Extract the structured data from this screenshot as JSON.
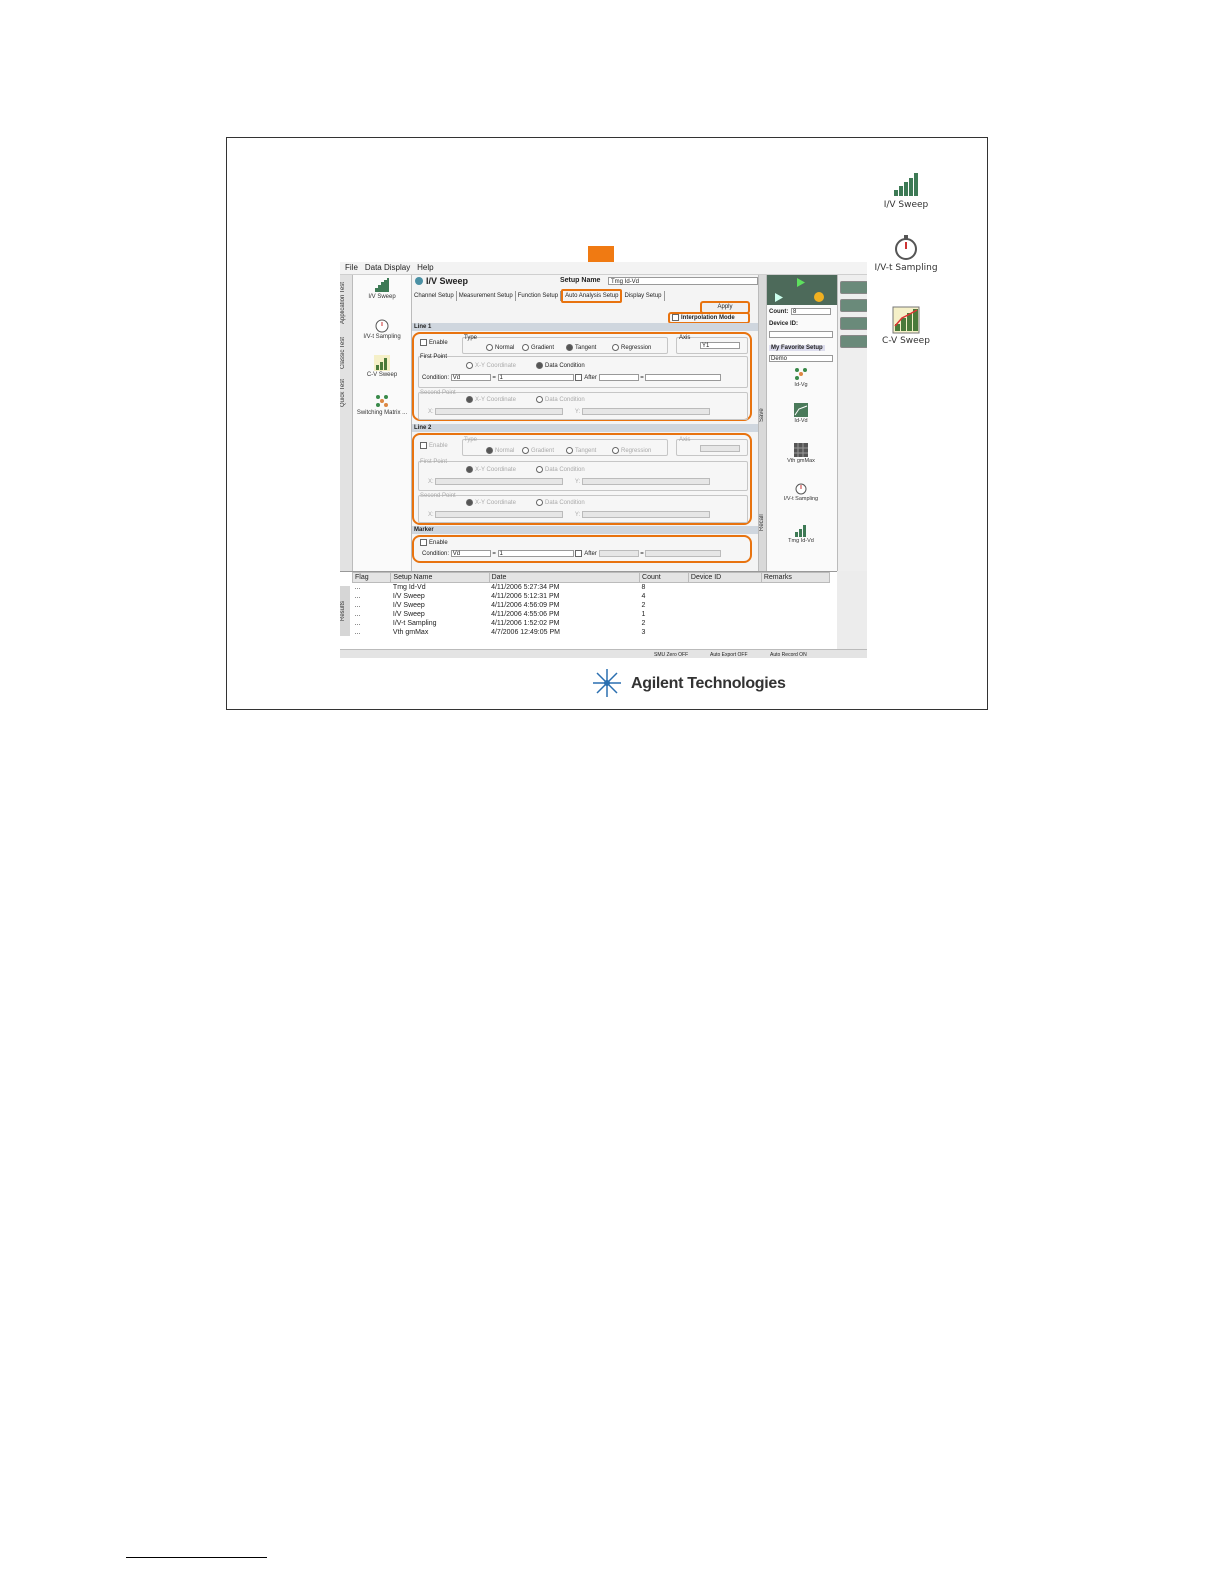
{
  "menu": [
    "File",
    "Data Display",
    "Help"
  ],
  "vertical_tabs": [
    "Application Test",
    "Classic Test",
    "Quick Test"
  ],
  "left_panel": [
    "I/V Sweep",
    "I/V-t Sampling",
    "C-V Sweep",
    "Switching Matrix ..."
  ],
  "window_title": "I/V Sweep",
  "setup_name_label": "Setup Name",
  "setup_name_value": "Tmg Id-Vd",
  "tabs": [
    "Channel Setup",
    "Measurement Setup",
    "Function Setup",
    "Auto Analysis Setup",
    "Display Setup"
  ],
  "apply_label": "Apply",
  "interpolation_label": "Interpolation Mode",
  "line1": {
    "header": "Line 1",
    "enable": "Enable",
    "type_label": "Type",
    "types": [
      "Normal",
      "Gradient",
      "Tangent",
      "Regression"
    ],
    "axis_label": "Axis",
    "axis_value": "Y1",
    "first_point": "First Point",
    "xy_coordinate": "X-Y Coordinate",
    "data_condition": "Data Condition",
    "condition_label": "Condition:",
    "condition_var": "Vd",
    "condition_val": "1",
    "after_label": "After",
    "second_point": "Second Point",
    "x_label": "X:",
    "y_label": "Y:"
  },
  "line2": {
    "header": "Line 2",
    "enable": "Enable",
    "type_label": "Type",
    "types": [
      "Normal",
      "Gradient",
      "Tangent",
      "Regression"
    ],
    "axis_label": "Axis",
    "first_point": "First Point",
    "second_point": "Second Point",
    "xy_coordinate": "X-Y Coordinate",
    "data_condition": "Data Condition",
    "x_label": "X:",
    "y_label": "Y:"
  },
  "marker": {
    "header": "Marker",
    "enable": "Enable",
    "condition_label": "Condition:",
    "condition_var": "Vd",
    "condition_val": "1",
    "after_label": "After"
  },
  "right_panel": {
    "count_label": "Count:",
    "count_value": "8",
    "device_id_label": "Device ID:",
    "favorite_label": "My Favorite Setup",
    "favorite_value": "Demo",
    "favorites": [
      "Id-Vg",
      "Id-Vd",
      "Vth gmMax",
      "I/V-t Sampling",
      "Tmg Id-Vd"
    ]
  },
  "side_strip": [
    "Save",
    "Recall"
  ],
  "results": {
    "tab_label": "Results",
    "columns": [
      "Flag",
      "Setup Name",
      "Date",
      "Count",
      "Device ID",
      "Remarks"
    ],
    "rows": [
      [
        "...",
        "Tmg Id-Vd",
        "4/11/2006 5:27:34 PM",
        "8",
        "",
        ""
      ],
      [
        "...",
        "I/V Sweep",
        "4/11/2006 5:12:31 PM",
        "4",
        "",
        ""
      ],
      [
        "...",
        "I/V Sweep",
        "4/11/2006 4:56:09 PM",
        "2",
        "",
        ""
      ],
      [
        "...",
        "I/V Sweep",
        "4/11/2006 4:55:06 PM",
        "1",
        "",
        ""
      ],
      [
        "...",
        "I/V-t Sampling",
        "4/11/2006 1:52:02 PM",
        "2",
        "",
        ""
      ],
      [
        "...",
        "Vth gmMax",
        "4/7/2006 12:49:05 PM",
        "3",
        "",
        ""
      ]
    ]
  },
  "status": [
    "SMU Zero OFF",
    "Auto Export OFF",
    "Auto Record ON"
  ],
  "desktop_icons": [
    "I/V Sweep",
    "I/V-t Sampling",
    "C-V Sweep"
  ],
  "logo_text": "Agilent Technologies",
  "colors": {
    "highlight": "#e8730f",
    "arrow": "#f07a12"
  }
}
